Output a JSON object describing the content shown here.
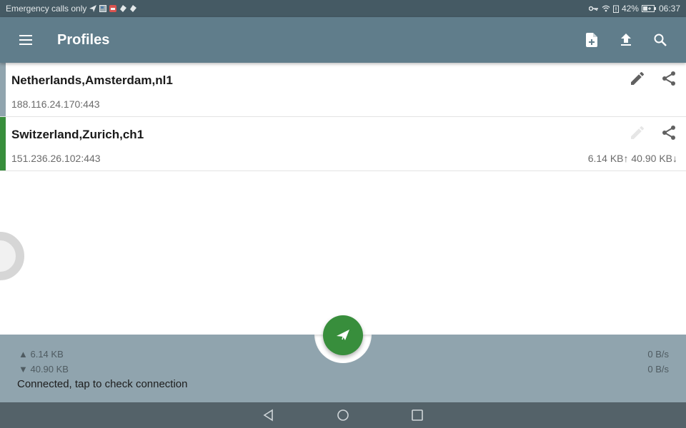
{
  "status_bar": {
    "carrier_text": "Emergency calls only",
    "battery_percent": "42%",
    "time": "06:37"
  },
  "app_bar": {
    "title": "Profiles",
    "actions": [
      "new-profile",
      "import",
      "search"
    ]
  },
  "profiles": [
    {
      "name": "Netherlands,Amsterdam,nl1",
      "address": "188.116.24.170:443",
      "traffic": "",
      "active": false,
      "indicator_color": "#90a4ae"
    },
    {
      "name": "Switzerland,Zurich,ch1",
      "address": "151.236.26.102:443",
      "traffic": "6.14 KB↑ 40.90 KB↓",
      "active": true,
      "indicator_color": "#388e3c"
    }
  ],
  "bottom_bar": {
    "uploaded": "▲ 6.14 KB",
    "downloaded": "▼ 40.90 KB",
    "upload_rate": "0 B/s",
    "download_rate": "0 B/s",
    "status": "Connected, tap to check connection"
  },
  "colors": {
    "app_bar": "#607d8b",
    "status_bar": "#455a64",
    "fab": "#388e3c",
    "bottom_bar": "#90a4ae"
  }
}
